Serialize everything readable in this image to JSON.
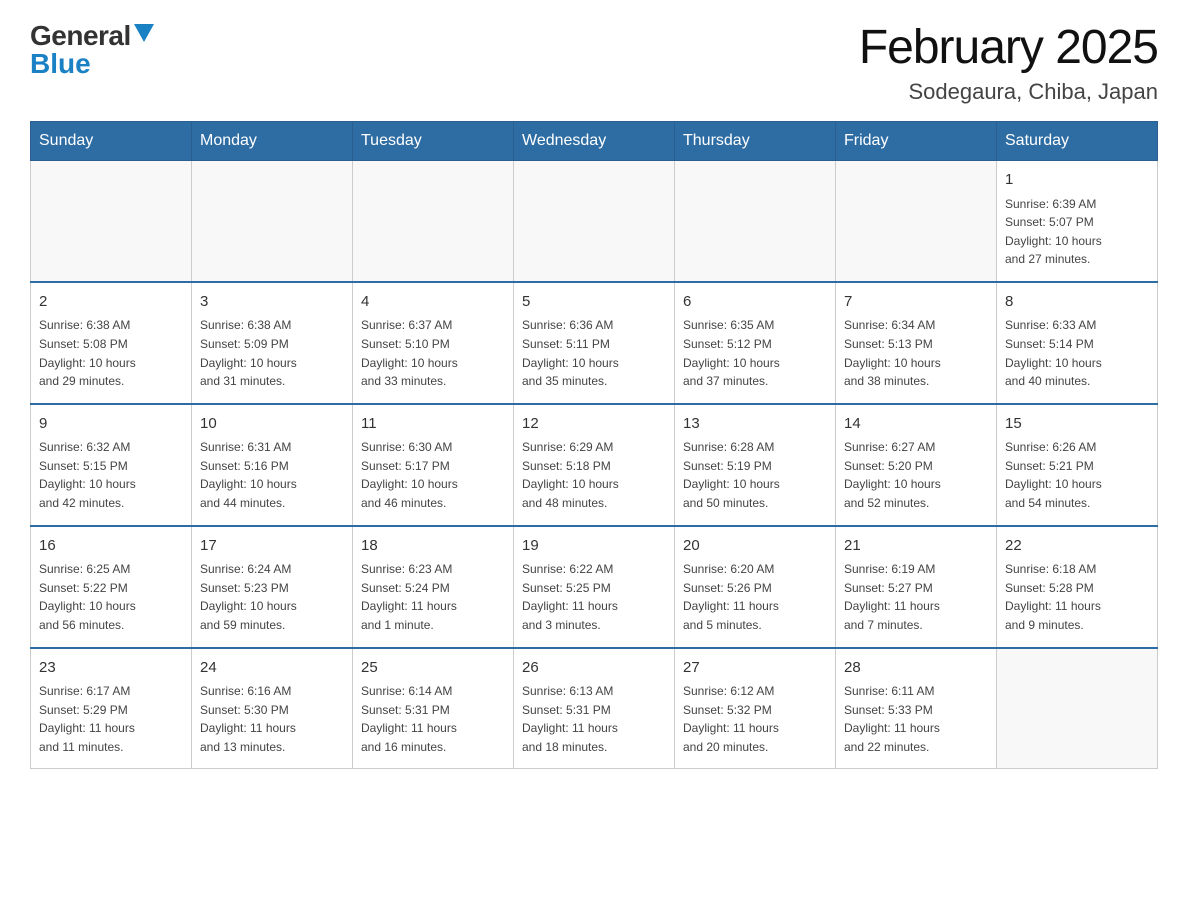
{
  "header": {
    "logo_general": "General",
    "logo_blue": "Blue",
    "main_title": "February 2025",
    "subtitle": "Sodegaura, Chiba, Japan"
  },
  "days_of_week": [
    "Sunday",
    "Monday",
    "Tuesday",
    "Wednesday",
    "Thursday",
    "Friday",
    "Saturday"
  ],
  "weeks": [
    [
      {
        "day": "",
        "info": ""
      },
      {
        "day": "",
        "info": ""
      },
      {
        "day": "",
        "info": ""
      },
      {
        "day": "",
        "info": ""
      },
      {
        "day": "",
        "info": ""
      },
      {
        "day": "",
        "info": ""
      },
      {
        "day": "1",
        "info": "Sunrise: 6:39 AM\nSunset: 5:07 PM\nDaylight: 10 hours\nand 27 minutes."
      }
    ],
    [
      {
        "day": "2",
        "info": "Sunrise: 6:38 AM\nSunset: 5:08 PM\nDaylight: 10 hours\nand 29 minutes."
      },
      {
        "day": "3",
        "info": "Sunrise: 6:38 AM\nSunset: 5:09 PM\nDaylight: 10 hours\nand 31 minutes."
      },
      {
        "day": "4",
        "info": "Sunrise: 6:37 AM\nSunset: 5:10 PM\nDaylight: 10 hours\nand 33 minutes."
      },
      {
        "day": "5",
        "info": "Sunrise: 6:36 AM\nSunset: 5:11 PM\nDaylight: 10 hours\nand 35 minutes."
      },
      {
        "day": "6",
        "info": "Sunrise: 6:35 AM\nSunset: 5:12 PM\nDaylight: 10 hours\nand 37 minutes."
      },
      {
        "day": "7",
        "info": "Sunrise: 6:34 AM\nSunset: 5:13 PM\nDaylight: 10 hours\nand 38 minutes."
      },
      {
        "day": "8",
        "info": "Sunrise: 6:33 AM\nSunset: 5:14 PM\nDaylight: 10 hours\nand 40 minutes."
      }
    ],
    [
      {
        "day": "9",
        "info": "Sunrise: 6:32 AM\nSunset: 5:15 PM\nDaylight: 10 hours\nand 42 minutes."
      },
      {
        "day": "10",
        "info": "Sunrise: 6:31 AM\nSunset: 5:16 PM\nDaylight: 10 hours\nand 44 minutes."
      },
      {
        "day": "11",
        "info": "Sunrise: 6:30 AM\nSunset: 5:17 PM\nDaylight: 10 hours\nand 46 minutes."
      },
      {
        "day": "12",
        "info": "Sunrise: 6:29 AM\nSunset: 5:18 PM\nDaylight: 10 hours\nand 48 minutes."
      },
      {
        "day": "13",
        "info": "Sunrise: 6:28 AM\nSunset: 5:19 PM\nDaylight: 10 hours\nand 50 minutes."
      },
      {
        "day": "14",
        "info": "Sunrise: 6:27 AM\nSunset: 5:20 PM\nDaylight: 10 hours\nand 52 minutes."
      },
      {
        "day": "15",
        "info": "Sunrise: 6:26 AM\nSunset: 5:21 PM\nDaylight: 10 hours\nand 54 minutes."
      }
    ],
    [
      {
        "day": "16",
        "info": "Sunrise: 6:25 AM\nSunset: 5:22 PM\nDaylight: 10 hours\nand 56 minutes."
      },
      {
        "day": "17",
        "info": "Sunrise: 6:24 AM\nSunset: 5:23 PM\nDaylight: 10 hours\nand 59 minutes."
      },
      {
        "day": "18",
        "info": "Sunrise: 6:23 AM\nSunset: 5:24 PM\nDaylight: 11 hours\nand 1 minute."
      },
      {
        "day": "19",
        "info": "Sunrise: 6:22 AM\nSunset: 5:25 PM\nDaylight: 11 hours\nand 3 minutes."
      },
      {
        "day": "20",
        "info": "Sunrise: 6:20 AM\nSunset: 5:26 PM\nDaylight: 11 hours\nand 5 minutes."
      },
      {
        "day": "21",
        "info": "Sunrise: 6:19 AM\nSunset: 5:27 PM\nDaylight: 11 hours\nand 7 minutes."
      },
      {
        "day": "22",
        "info": "Sunrise: 6:18 AM\nSunset: 5:28 PM\nDaylight: 11 hours\nand 9 minutes."
      }
    ],
    [
      {
        "day": "23",
        "info": "Sunrise: 6:17 AM\nSunset: 5:29 PM\nDaylight: 11 hours\nand 11 minutes."
      },
      {
        "day": "24",
        "info": "Sunrise: 6:16 AM\nSunset: 5:30 PM\nDaylight: 11 hours\nand 13 minutes."
      },
      {
        "day": "25",
        "info": "Sunrise: 6:14 AM\nSunset: 5:31 PM\nDaylight: 11 hours\nand 16 minutes."
      },
      {
        "day": "26",
        "info": "Sunrise: 6:13 AM\nSunset: 5:31 PM\nDaylight: 11 hours\nand 18 minutes."
      },
      {
        "day": "27",
        "info": "Sunrise: 6:12 AM\nSunset: 5:32 PM\nDaylight: 11 hours\nand 20 minutes."
      },
      {
        "day": "28",
        "info": "Sunrise: 6:11 AM\nSunset: 5:33 PM\nDaylight: 11 hours\nand 22 minutes."
      },
      {
        "day": "",
        "info": ""
      }
    ]
  ]
}
